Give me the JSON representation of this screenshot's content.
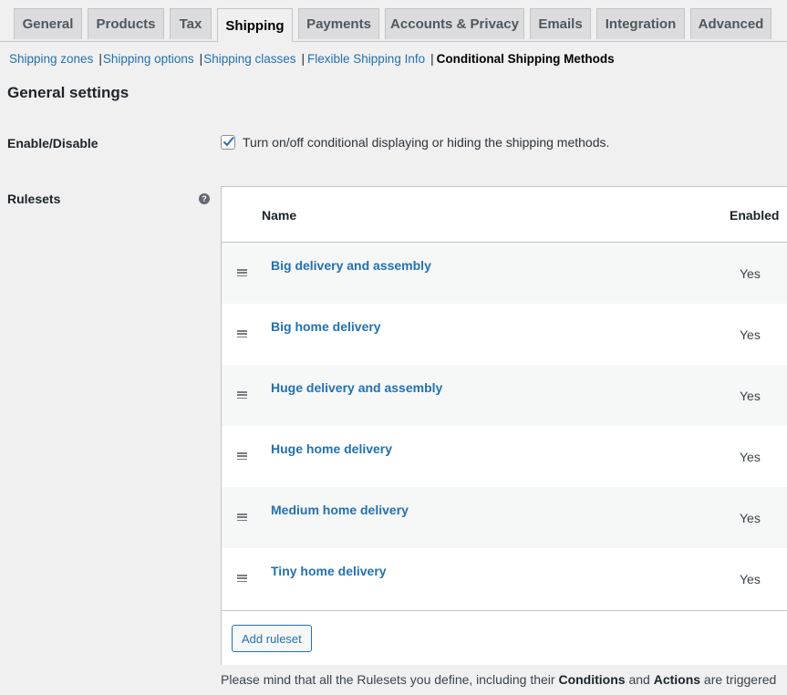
{
  "tabs": [
    {
      "label": "General"
    },
    {
      "label": "Products"
    },
    {
      "label": "Tax"
    },
    {
      "label": "Shipping",
      "active": true
    },
    {
      "label": "Payments"
    },
    {
      "label": "Accounts & Privacy"
    },
    {
      "label": "Emails"
    },
    {
      "label": "Integration"
    },
    {
      "label": "Advanced"
    }
  ],
  "subnav": {
    "items": [
      "Shipping zones",
      "Shipping options",
      "Shipping classes",
      "Flexible Shipping Info"
    ],
    "separator": "|",
    "current": "Conditional Shipping Methods"
  },
  "general": {
    "title": "General settings",
    "enable_label": "Enable/Disable",
    "enable_checked": true,
    "enable_description": "Turn on/off conditional displaying or hiding the shipping methods."
  },
  "rulesets": {
    "label": "Rulesets",
    "help_icon": "?",
    "columns": {
      "name": "Name",
      "enabled": "Enabled"
    },
    "rows": [
      {
        "name": "Big delivery and assembly",
        "enabled": "Yes"
      },
      {
        "name": "Big home delivery",
        "enabled": "Yes"
      },
      {
        "name": "Huge delivery and assembly",
        "enabled": "Yes"
      },
      {
        "name": "Huge home delivery",
        "enabled": "Yes"
      },
      {
        "name": "Medium home delivery",
        "enabled": "Yes"
      },
      {
        "name": "Tiny home delivery",
        "enabled": "Yes"
      }
    ],
    "add_button": "Add ruleset"
  },
  "note": {
    "part1": "Please mind that all the Rulesets you define, including their ",
    "bold1": "Conditions",
    "part2": " and ",
    "bold2": "Actions",
    "part3": " are triggered"
  },
  "colors": {
    "link": "#2271b1",
    "background": "#f0f0f1",
    "tab_bg": "#dcdcde"
  }
}
